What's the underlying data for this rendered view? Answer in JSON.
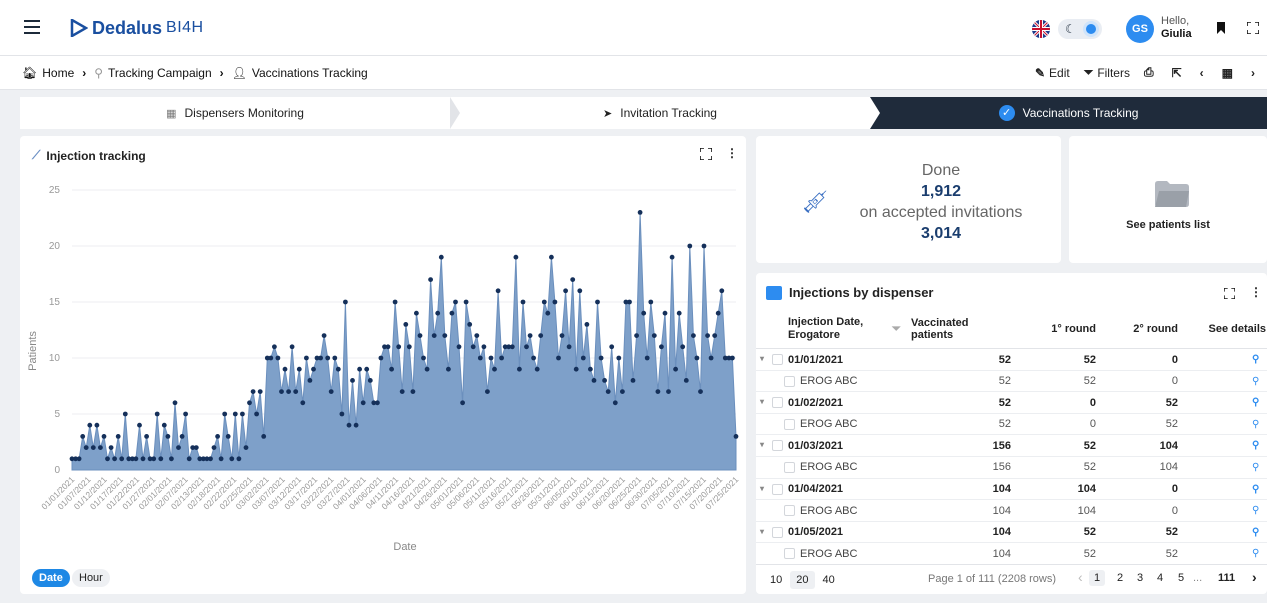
{
  "header": {
    "brand": "Dedalus",
    "brand_sub": "BI4H",
    "user_initials": "GS",
    "hello": "Hello,",
    "user_name": "Giulia"
  },
  "breadcrumb": [
    {
      "label": "Home",
      "icon": "home-icon"
    },
    {
      "label": "Tracking Campaign",
      "icon": "tracking-icon"
    },
    {
      "label": "Vaccinations Tracking",
      "icon": "user-check-icon"
    }
  ],
  "toolbar": {
    "edit": "Edit",
    "filters": "Filters"
  },
  "steps": [
    "Dispensers Monitoring",
    "Invitation Tracking",
    "Vaccinations Tracking"
  ],
  "chart_panel": {
    "title": "Injection tracking",
    "toggle_date": "Date",
    "toggle_hour": "Hour"
  },
  "chart_data": {
    "type": "area",
    "xlabel": "Date",
    "ylabel": "Patients",
    "ylim": [
      0,
      25
    ],
    "yticks": [
      0,
      5,
      10,
      15,
      20,
      25
    ],
    "x_tick_labels": [
      "01/01/2021",
      "01/07/2021",
      "01/12/2021",
      "01/17/2021",
      "01/22/2021",
      "01/27/2021",
      "02/01/2021",
      "02/07/2021",
      "02/13/2021",
      "02/18/2021",
      "02/22/2021",
      "02/25/2021",
      "03/02/2021",
      "03/07/2021",
      "03/12/2021",
      "03/17/2021",
      "03/22/2021",
      "03/27/2021",
      "04/01/2021",
      "04/06/2021",
      "04/11/2021",
      "04/16/2021",
      "04/21/2021",
      "04/26/2021",
      "05/01/2021",
      "05/06/2021",
      "05/11/2021",
      "05/16/2021",
      "05/21/2021",
      "05/26/2021",
      "05/31/2021",
      "06/05/2021",
      "06/10/2021",
      "06/15/2021",
      "06/20/2021",
      "06/25/2021",
      "06/30/2021",
      "07/05/2021",
      "07/10/2021",
      "07/15/2021",
      "07/20/2021",
      "07/25/2021"
    ],
    "values": [
      1,
      1,
      1,
      3,
      2,
      4,
      2,
      4,
      2,
      3,
      1,
      2,
      1,
      3,
      1,
      5,
      1,
      1,
      1,
      4,
      1,
      3,
      1,
      1,
      5,
      1,
      4,
      3,
      1,
      6,
      2,
      3,
      5,
      1,
      2,
      2,
      1,
      1,
      1,
      1,
      2,
      3,
      1,
      5,
      3,
      1,
      5,
      1,
      5,
      2,
      6,
      7,
      5,
      7,
      3,
      10,
      10,
      11,
      10,
      7,
      9,
      7,
      11,
      7,
      9,
      6,
      10,
      8,
      9,
      10,
      10,
      12,
      10,
      7,
      10,
      9,
      5,
      15,
      4,
      8,
      4,
      9,
      6,
      9,
      8,
      6,
      6,
      10,
      11,
      11,
      9,
      15,
      11,
      7,
      13,
      11,
      7,
      14,
      12,
      10,
      9,
      17,
      12,
      14,
      19,
      12,
      9,
      14,
      15,
      11,
      6,
      15,
      13,
      11,
      12,
      10,
      11,
      7,
      10,
      9,
      16,
      10,
      11,
      11,
      11,
      19,
      9,
      15,
      11,
      12,
      10,
      9,
      12,
      15,
      14,
      19,
      15,
      10,
      12,
      16,
      11,
      17,
      9,
      16,
      10,
      13,
      9,
      8,
      15,
      10,
      8,
      7,
      11,
      6,
      10,
      7,
      15,
      15,
      8,
      12,
      23,
      14,
      10,
      15,
      12,
      7,
      11,
      14,
      7,
      19,
      9,
      14,
      11,
      8,
      20,
      12,
      10,
      7,
      20,
      12,
      10,
      12,
      14,
      16,
      10,
      10,
      10,
      3
    ]
  },
  "summary": {
    "done_label": "Done",
    "done_value": "1,912",
    "accepted_label": "on accepted invitations",
    "accepted_value": "3,014",
    "see_patients": "See patients list"
  },
  "table": {
    "title": "Injections by dispenser",
    "columns": [
      "Injection Date, Erogatore",
      "Vaccinated patients",
      "1° round",
      "2° round",
      "See details"
    ],
    "rows": [
      {
        "group": true,
        "label": "01/01/2021",
        "vaccinated": "52",
        "r1": "52",
        "r2": "0"
      },
      {
        "group": false,
        "label": "EROG ABC",
        "vaccinated": "52",
        "r1": "52",
        "r2": "0"
      },
      {
        "group": true,
        "label": "01/02/2021",
        "vaccinated": "52",
        "r1": "0",
        "r2": "52"
      },
      {
        "group": false,
        "label": "EROG ABC",
        "vaccinated": "52",
        "r1": "0",
        "r2": "52"
      },
      {
        "group": true,
        "label": "01/03/2021",
        "vaccinated": "156",
        "r1": "52",
        "r2": "104"
      },
      {
        "group": false,
        "label": "EROG ABC",
        "vaccinated": "156",
        "r1": "52",
        "r2": "104"
      },
      {
        "group": true,
        "label": "01/04/2021",
        "vaccinated": "104",
        "r1": "104",
        "r2": "0"
      },
      {
        "group": false,
        "label": "EROG ABC",
        "vaccinated": "104",
        "r1": "104",
        "r2": "0"
      },
      {
        "group": true,
        "label": "01/05/2021",
        "vaccinated": "104",
        "r1": "52",
        "r2": "52"
      },
      {
        "group": false,
        "label": "EROG ABC",
        "vaccinated": "104",
        "r1": "52",
        "r2": "52"
      }
    ],
    "page_sizes": [
      "10",
      "20",
      "40"
    ],
    "page_info": "Page 1 of 111 (2208 rows)",
    "pages": [
      "1",
      "2",
      "3",
      "4",
      "5",
      "...",
      "111"
    ]
  },
  "colors": {
    "accent": "#2d8cf0",
    "area_fill": "#7ea0c9",
    "point": "#15305a",
    "dark_step": "#1f2b3b"
  }
}
